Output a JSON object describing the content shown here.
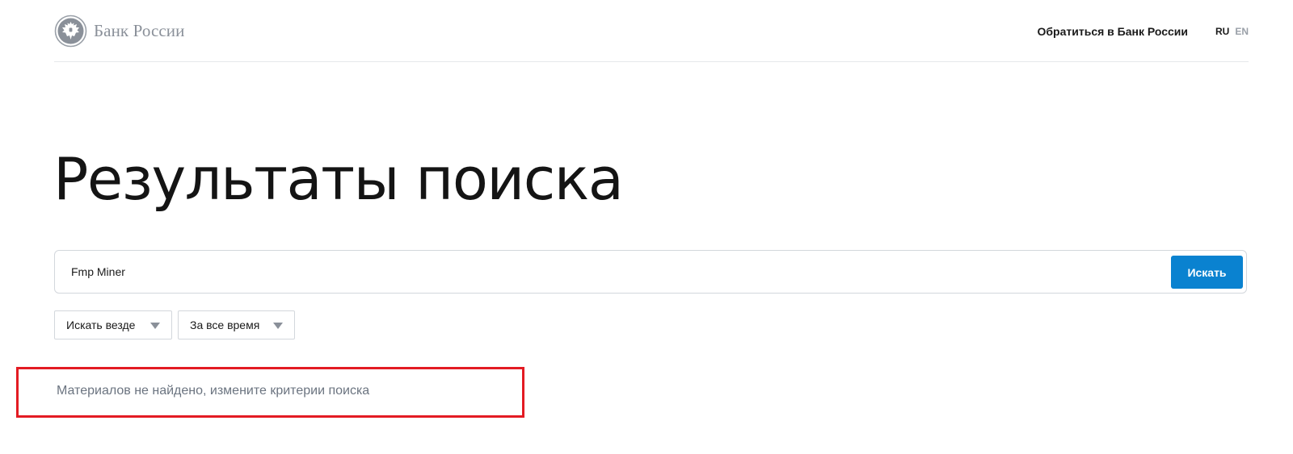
{
  "header": {
    "logo_text": "Банк России",
    "contact_link": "Обратиться в Банк России",
    "languages": [
      "RU",
      "EN"
    ],
    "active_language": "RU"
  },
  "page": {
    "title": "Результаты поиска"
  },
  "search": {
    "query": "Fmp Miner",
    "button_label": "Искать"
  },
  "filters": {
    "where": "Искать везде",
    "when": "За все время"
  },
  "results": {
    "message": "Материалов не найдено, измените критерии поиска"
  },
  "colors": {
    "accent": "#0a82d0",
    "highlight_border": "#e31b23",
    "muted_text": "#6b7480"
  }
}
